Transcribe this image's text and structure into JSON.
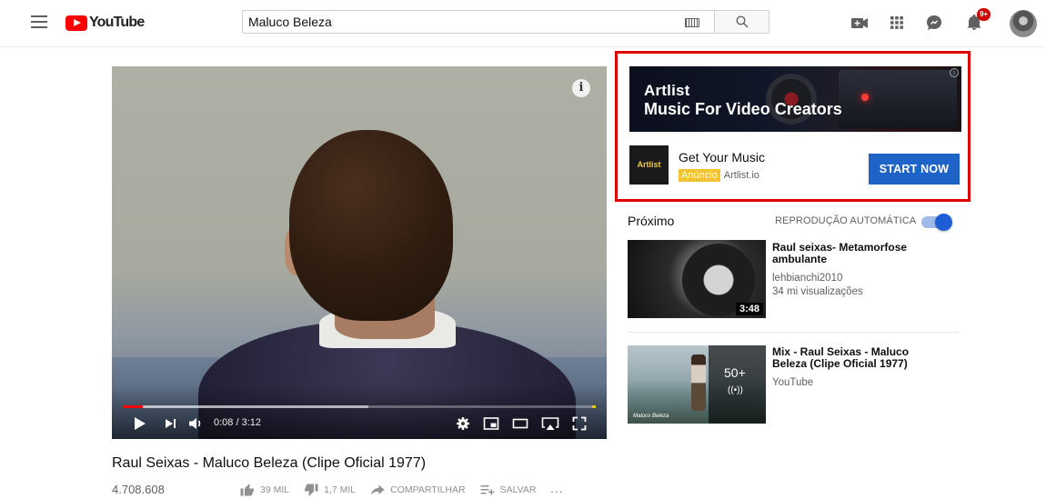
{
  "masthead": {
    "logo_text": "YouTube",
    "search_value": "Maluco Beleza",
    "notification_count": "9+",
    "icons": [
      "menu-icon",
      "keyboard-icon",
      "search-icon",
      "create-video-icon",
      "apps-grid-icon",
      "messages-icon",
      "bell-icon",
      "avatar"
    ]
  },
  "player": {
    "current_time": "0:08",
    "duration": "3:12",
    "time_display": "0:08 / 3:12",
    "played_fraction": 0.042,
    "buffered_fraction": 0.52,
    "info_glyph": "i"
  },
  "video": {
    "title": "Raul Seixas - Maluco Beleza (Clipe Oficial 1977)",
    "views": "4.708.608",
    "likes": "39 MIL",
    "dislikes": "1,7 MIL",
    "share_label": "COMPARTILHAR",
    "save_label": "SALVAR",
    "more_label": "..."
  },
  "ad": {
    "brand": "Artlist",
    "headline": "Music For Video Creators",
    "logo_text": "Artlist",
    "title": "Get Your Music",
    "badge": "Anúncio",
    "domain": "Artlist.io",
    "cta": "START NOW",
    "info_glyph": "i",
    "highlight_color": "#dd0000",
    "cta_color": "#1e64c8"
  },
  "sidebar": {
    "up_next_label": "Próximo",
    "autoplay_label": "REPRODUÇÃO AUTOMÁTICA",
    "autoplay_on": true,
    "items": [
      {
        "title": "Raul seixas- Metamorfose ambulante",
        "channel": "lehbianchi2010",
        "views": "34 mi visualizações",
        "duration": "3:48"
      },
      {
        "title": "Mix - Raul Seixas - Maluco Beleza (Clipe Oficial 1977)",
        "channel": "YouTube",
        "count": "50+",
        "radio_glyph": "((•))",
        "thumb_caption": "Maluco Beleza"
      }
    ]
  }
}
